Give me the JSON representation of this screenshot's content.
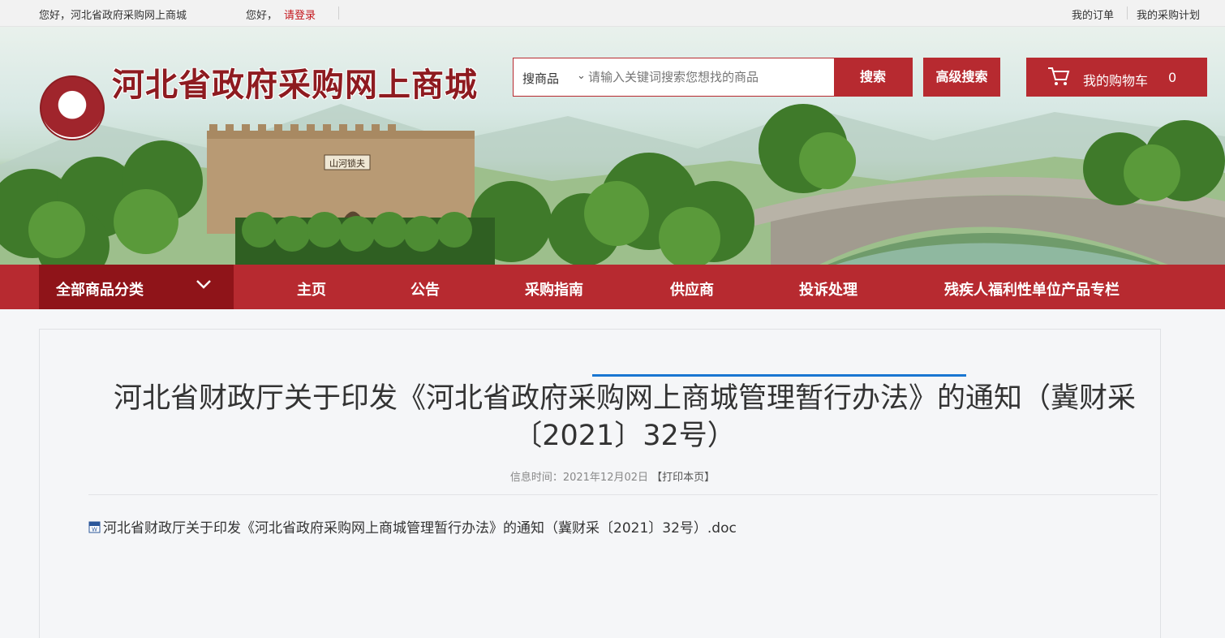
{
  "topbar": {
    "greeting": "您好，河北省政府采购网上商城",
    "greeting2": "您好，",
    "login": "请登录",
    "my_orders": "我的订单",
    "my_plan": "我的采购计划"
  },
  "header": {
    "site_name": "河北省政府采购网上商城",
    "search_category": "搜商品",
    "search_placeholder": "请输入关键词搜索您想找的商品",
    "search_button": "搜索",
    "advanced_search": "高级搜索",
    "cart_label": "我的购物车",
    "cart_count": "0",
    "banner_plaque": "山河锁夫"
  },
  "nav": {
    "all_categories": "全部商品分类",
    "items": [
      "主页",
      "公告",
      "采购指南",
      "供应商",
      "投诉处理",
      "残疾人福利性单位产品专栏"
    ]
  },
  "article": {
    "title": "河北省财政厅关于印发《河北省政府采购网上商城管理暂行办法》的通知（冀财采〔2021〕32号）",
    "meta_label": "信息时间：",
    "date": "2021年12月02日",
    "print": "【打印本页】",
    "attachment": "河北省财政厅关于印发《河北省政府采购网上商城管理暂行办法》的通知（冀财采〔2021〕32号）.doc"
  },
  "colors": {
    "brand_red": "#b72a30",
    "dark_red": "#8f1419",
    "link_blue": "#1976d2"
  }
}
